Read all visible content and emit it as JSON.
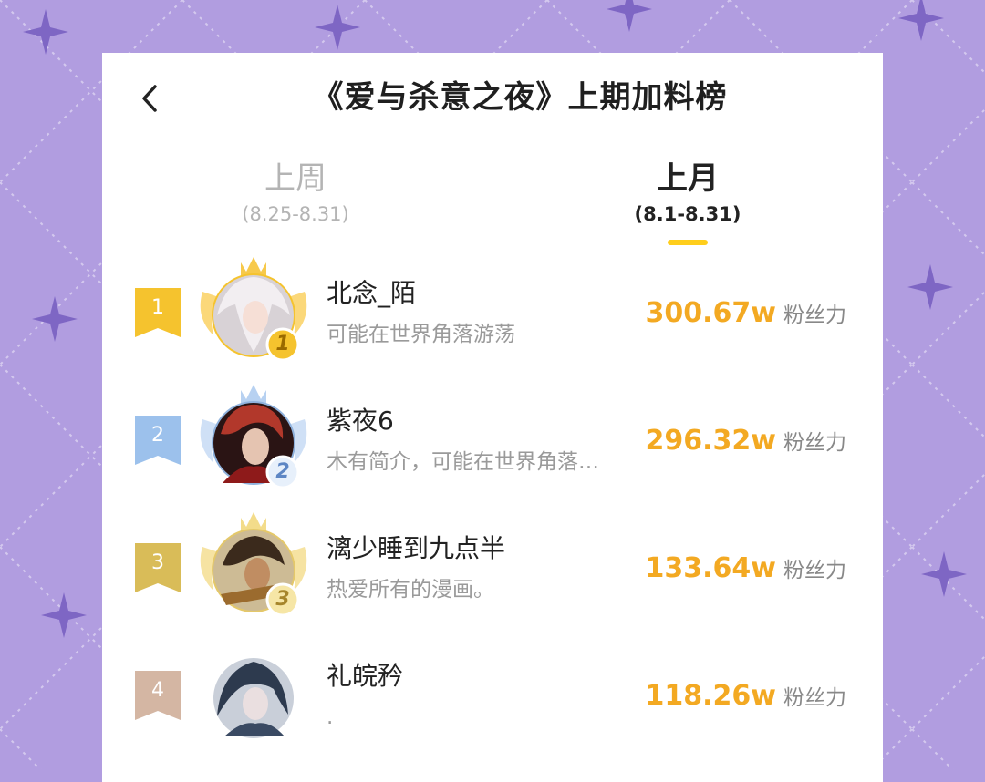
{
  "header": {
    "back_label": "‹",
    "title": "《爱与杀意之夜》上期加料榜"
  },
  "tabs": [
    {
      "label": "上周",
      "range": "(8.25-8.31)",
      "active": false
    },
    {
      "label": "上月",
      "range": "(8.1-8.31)",
      "active": true
    }
  ],
  "ranking": [
    {
      "rank": "1",
      "name": "北念_陌",
      "bio": "可能在世界角落游荡",
      "score": "300.67w",
      "unit": "粉丝力",
      "badge": "1"
    },
    {
      "rank": "2",
      "name": "紫夜6",
      "bio": "木有简介，可能在世界角落…",
      "score": "296.32w",
      "unit": "粉丝力",
      "badge": "2"
    },
    {
      "rank": "3",
      "name": "漓少睡到九点半",
      "bio": "热爱所有的漫画。",
      "score": "133.64w",
      "unit": "粉丝力",
      "badge": "3"
    },
    {
      "rank": "4",
      "name": "礼皖矜",
      "bio": ".",
      "score": "118.26w",
      "unit": "粉丝力",
      "badge": ""
    }
  ],
  "colors": {
    "background": "#b19de0",
    "accent": "#f3a922",
    "underline": "#ffce1c",
    "gold": "#f5c32e",
    "silver": "#9cc1ec",
    "bronze": "#d9bc58",
    "rank4": "#d4b6a3"
  }
}
